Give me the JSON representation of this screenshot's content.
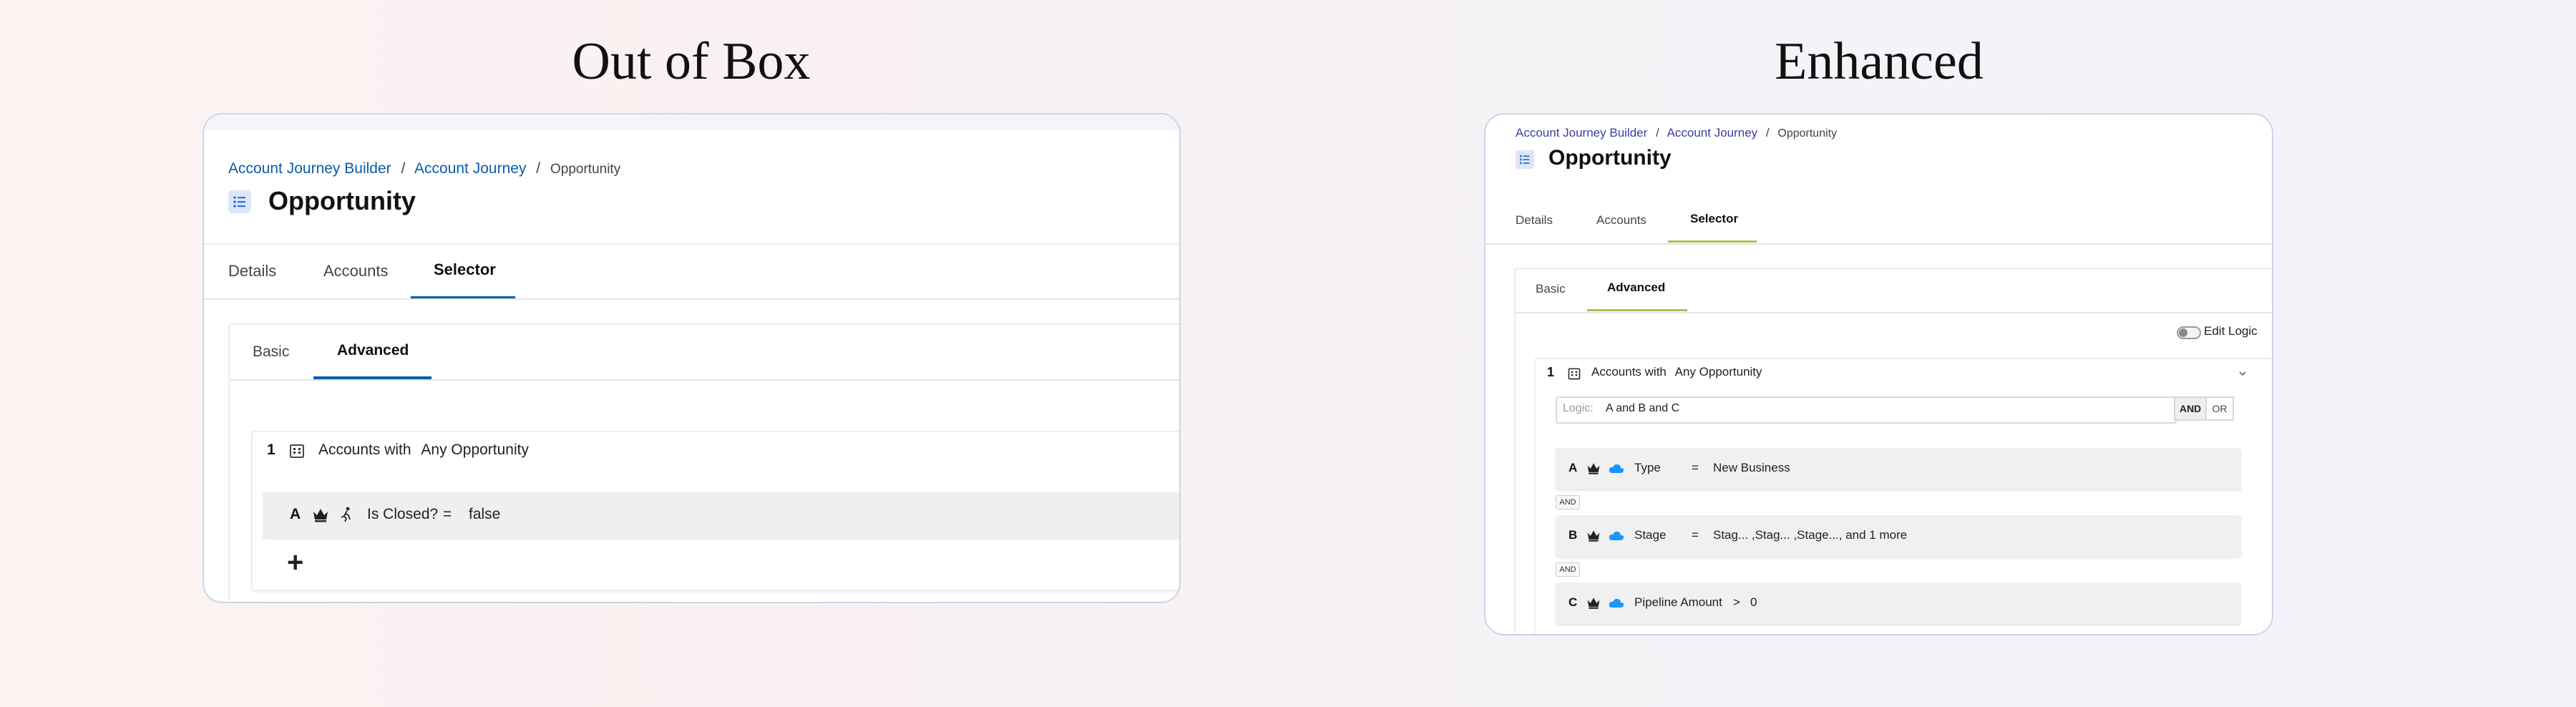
{
  "headings": {
    "left": "Out of Box",
    "right": "Enhanced"
  },
  "colors": {
    "link": "#0b5cab",
    "left_accent": "#0b5cab",
    "right_accent": "#a9c257",
    "right_link": "#3d3da9",
    "cloud": "#1b96ff"
  },
  "left": {
    "breadcrumb": {
      "item1": "Account Journey Builder",
      "sep1": "/",
      "item2": "Account Journey",
      "sep2": "/",
      "current": "Opportunity"
    },
    "page_title": "Opportunity",
    "tabs": {
      "details": "Details",
      "accounts": "Accounts",
      "selector": "Selector"
    },
    "subtabs": {
      "basic": "Basic",
      "advanced": "Advanced"
    },
    "group": {
      "number": "1",
      "label": "Accounts with",
      "value": "Any Opportunity"
    },
    "condition": {
      "letter": "A",
      "field": "Is Closed?",
      "operator": "=",
      "value": "false"
    },
    "add": "+"
  },
  "right": {
    "breadcrumb": {
      "item1": "Account Journey Builder",
      "sep1": "/",
      "item2": "Account Journey",
      "sep2": "/",
      "current": "Opportunity"
    },
    "page_title": "Opportunity",
    "tabs": {
      "details": "Details",
      "accounts": "Accounts",
      "selector": "Selector"
    },
    "subtabs": {
      "basic": "Basic",
      "advanced": "Advanced"
    },
    "edit_logic": "Edit Logic",
    "group": {
      "number": "1",
      "label": "Accounts with",
      "value": "Any Opportunity"
    },
    "logic": {
      "label": "Logic:",
      "value": "A and B and C",
      "and_btn": "AND",
      "or_btn": "OR"
    },
    "conditions": [
      {
        "letter": "A",
        "field": "Type",
        "operator": "=",
        "value": "New Business"
      },
      {
        "letter": "B",
        "field": "Stage",
        "operator": "=",
        "value": "Stag... ,Stag... ,Stage..., and 1 more"
      },
      {
        "letter": "C",
        "field": "Pipeline Amount",
        "operator": ">",
        "value": "0"
      }
    ],
    "connectors": [
      "AND",
      "AND"
    ]
  }
}
